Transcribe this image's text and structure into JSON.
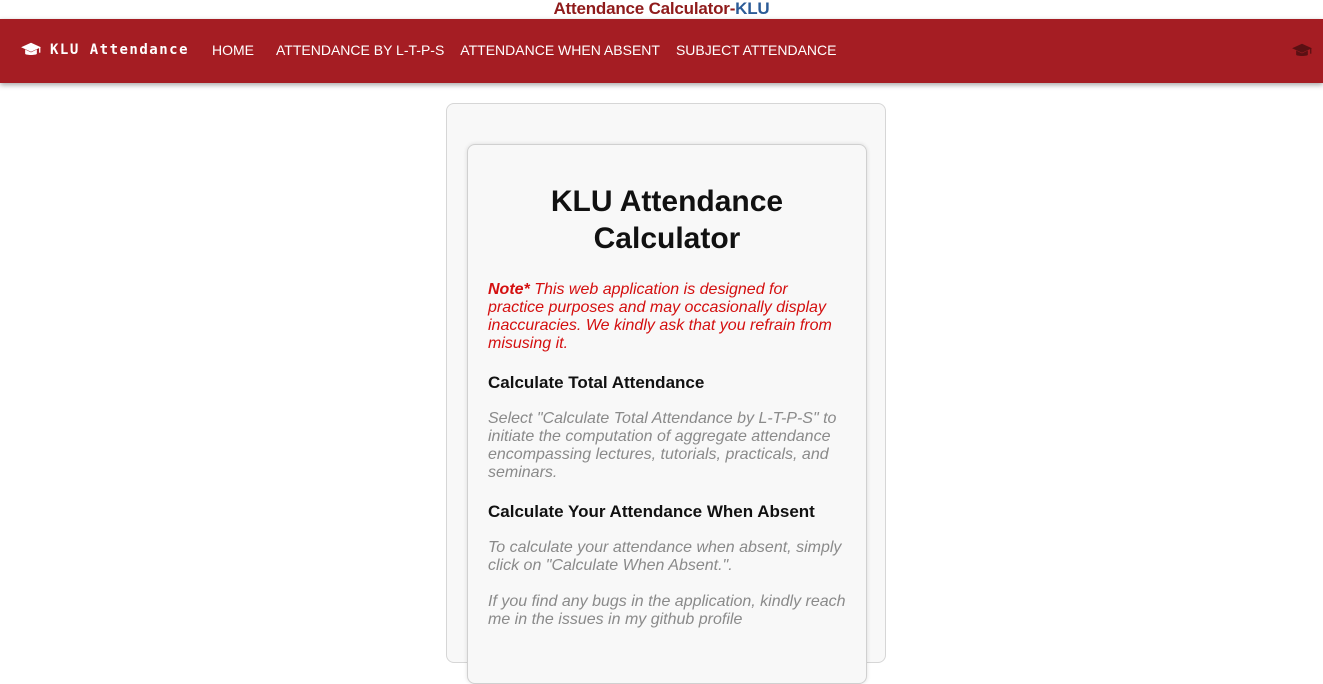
{
  "top_title": {
    "part1": "Attendance Calculator-",
    "part2": "KLU"
  },
  "navbar": {
    "brand": "KLU Attendance",
    "brand_icon": "graduation-cap-icon",
    "links": [
      "HOME",
      "ATTENDANCE BY L-T-P-S",
      "ATTENDANCE WHEN ABSENT",
      "SUBJECT ATTENDANCE"
    ],
    "right_icon": "graduation-cap-icon"
  },
  "card": {
    "title": "KLU Attendance Calculator",
    "note_label": "Note*",
    "note_text": " This web application is designed for practice purposes and may occasionally display inaccuracies. We kindly ask that you refrain from misusing it.",
    "section1_heading": "Calculate Total Attendance",
    "section1_text": "Select \"Calculate Total Attendance by L-T-P-S\" to initiate the computation of aggregate attendance encompassing lectures, tutorials, practicals, and seminars.",
    "section2_heading": "Calculate Your Attendance When Absent",
    "section2_text": "To calculate your attendance when absent, simply click on \"Calculate When Absent.\".",
    "bugs_text": "If you find any bugs in the application, kindly reach me in the issues in my github profile"
  },
  "colors": {
    "navbar": "#a51d23",
    "title_red": "#8f1b1b",
    "title_blue": "#2b5b97",
    "note_red": "#d40f0f",
    "muted_text": "#8a8a8a"
  }
}
